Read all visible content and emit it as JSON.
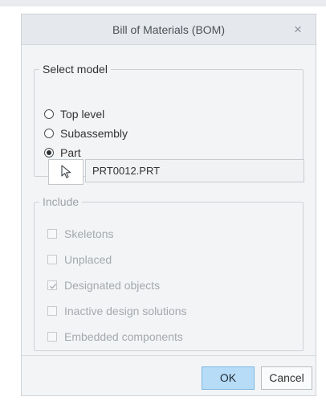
{
  "dialog": {
    "title": "Bill of Materials (BOM)",
    "close_glyph": "×"
  },
  "select_model": {
    "legend": "Select model",
    "options": [
      {
        "label": "Top level",
        "selected": false
      },
      {
        "label": "Subassembly",
        "selected": false
      },
      {
        "label": "Part",
        "selected": true
      }
    ],
    "selector_icon": "cursor-arrow-icon",
    "model_value": "PRT0012.PRT"
  },
  "include": {
    "legend": "Include",
    "items": [
      {
        "label": "Skeletons",
        "checked": false
      },
      {
        "label": "Unplaced",
        "checked": false
      },
      {
        "label": "Designated objects",
        "checked": true
      },
      {
        "label": "Inactive design solutions",
        "checked": false
      },
      {
        "label": "Embedded components",
        "checked": false
      }
    ]
  },
  "buttons": {
    "ok": "OK",
    "cancel": "Cancel"
  },
  "colors": {
    "ok_fill": "#b6dcf7",
    "ok_border": "#7cb7e4",
    "disabled_text": "#a4a9ae"
  }
}
